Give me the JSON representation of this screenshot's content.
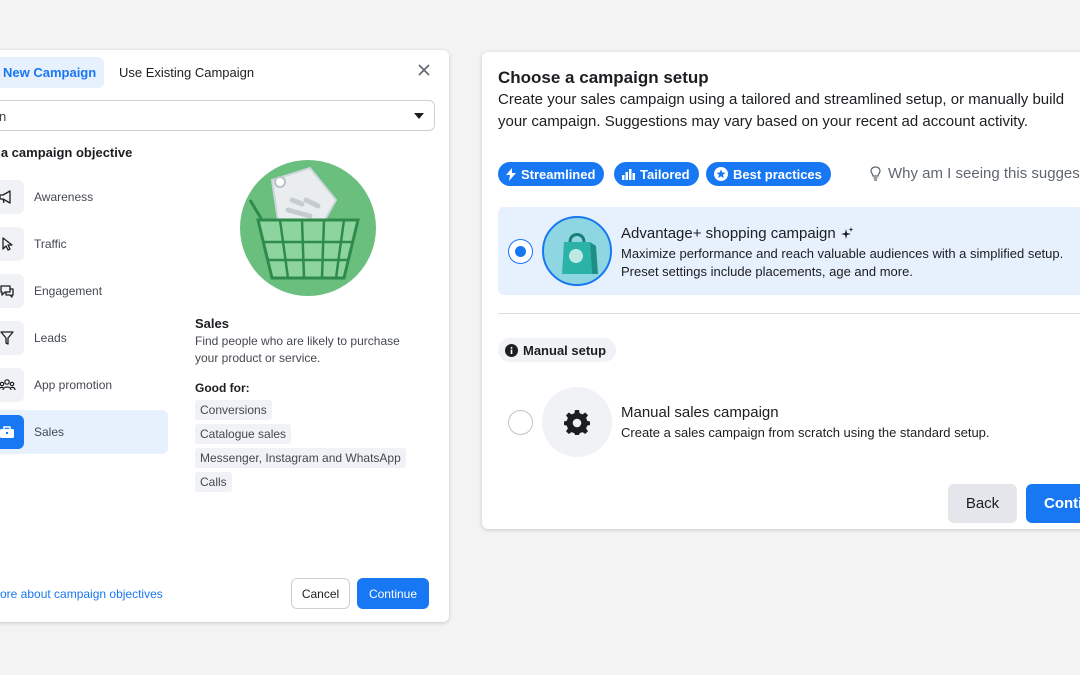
{
  "left_dialog": {
    "tabs": [
      {
        "label": "New Campaign",
        "active": true
      },
      {
        "label": "Use Existing Campaign",
        "active": false
      }
    ],
    "select_value": "n",
    "objective_heading": "e a campaign objective",
    "objectives": [
      {
        "label": "Awareness",
        "icon": "megaphone-icon"
      },
      {
        "label": "Traffic",
        "icon": "cursor-icon"
      },
      {
        "label": "Engagement",
        "icon": "chat-bubble-icon"
      },
      {
        "label": "Leads",
        "icon": "funnel-icon"
      },
      {
        "label": "App promotion",
        "icon": "people-icon"
      },
      {
        "label": "Sales",
        "icon": "briefcase-icon",
        "selected": true
      }
    ],
    "detail": {
      "title": "Sales",
      "description": "Find people who are likely to purchase your product or service.",
      "good_for_title": "Good for:",
      "good_for": [
        "Conversions",
        "Catalogue sales",
        "Messenger, Instagram and WhatsApp",
        "Calls"
      ]
    },
    "learn_link": "more about campaign objectives",
    "cancel_label": "Cancel",
    "continue_label": "Continue"
  },
  "right_card": {
    "title": "Choose a campaign setup",
    "subtitle": "Create your sales campaign using a tailored and streamlined setup, or manually build your campaign. Suggestions may vary based on your recent ad account activity.",
    "pills": [
      {
        "label": "Streamlined",
        "icon": "lightning-icon"
      },
      {
        "label": "Tailored",
        "icon": "bar-chart-icon"
      },
      {
        "label": "Best practices",
        "icon": "star-icon"
      }
    ],
    "why_text": "Why am I seeing this sugges",
    "advantage_option": {
      "title": "Advantage+ shopping campaign",
      "description": "Maximize performance and reach valuable audiences with a simplified setup. Preset settings include placements, age and more.",
      "selected": true
    },
    "manual_tag": "Manual setup",
    "manual_option": {
      "title": "Manual sales campaign",
      "description": "Create a sales campaign from scratch using the standard setup.",
      "selected": false
    },
    "back_label": "Back",
    "continue_label": "Conti"
  },
  "colors": {
    "accent": "#1877f2",
    "selected_bg": "#e7f0fd",
    "art_green": "#6bbf7e"
  }
}
